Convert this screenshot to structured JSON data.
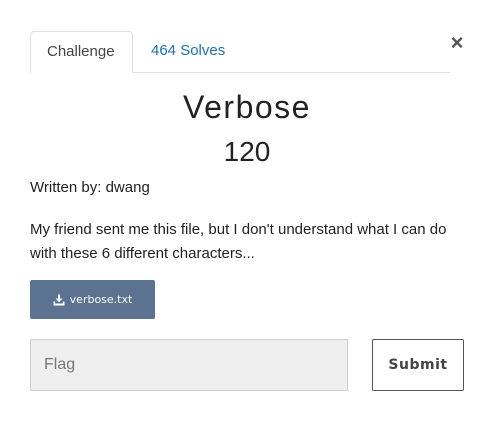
{
  "tabs": [
    {
      "label": "Challenge",
      "active": true
    },
    {
      "label": "464 Solves",
      "active": false
    }
  ],
  "close_glyph": "×",
  "challenge": {
    "name": "Verbose",
    "points": "120",
    "author_prefix": "Written by: ",
    "author": "dwang",
    "description": "My friend sent me this file, but I don't understand what I can do with these 6 different characters..."
  },
  "file": {
    "name": "verbose.txt",
    "icon": "download-icon"
  },
  "flag_form": {
    "placeholder": "Flag",
    "value": "",
    "submit_label": "Submit"
  },
  "colors": {
    "link": "#1f6fb0",
    "file_button_bg": "#5b7290",
    "input_bg": "#efefef"
  }
}
